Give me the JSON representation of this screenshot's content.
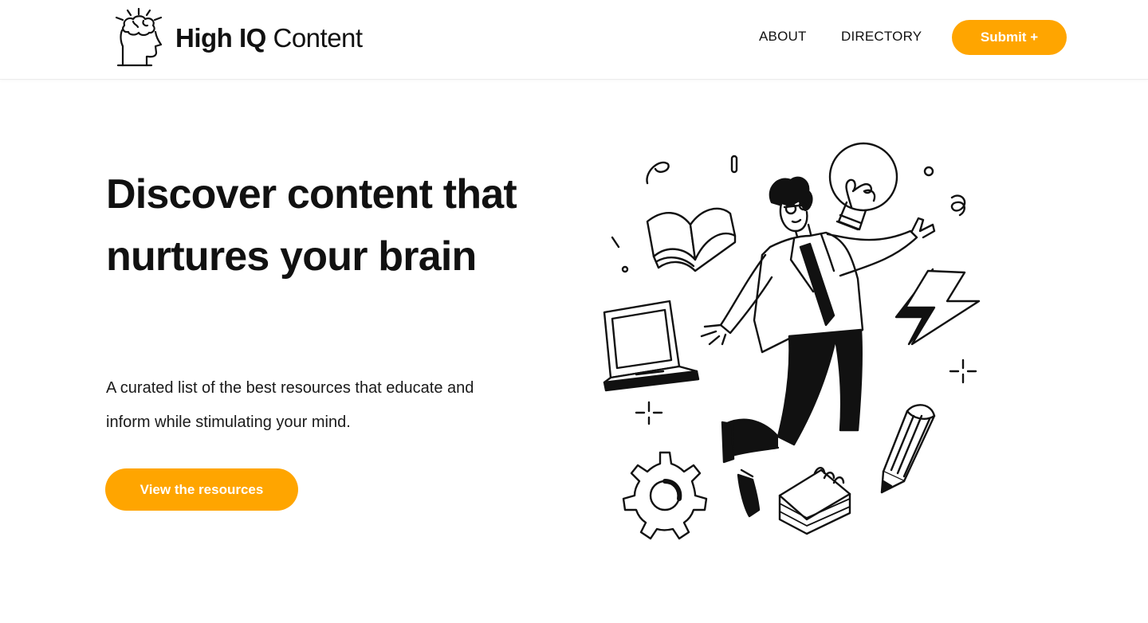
{
  "colors": {
    "accent": "#FFA500",
    "text": "#111111",
    "background": "#ffffff"
  },
  "header": {
    "brand": {
      "bold": "High IQ",
      "light": " Content",
      "logo_icon": "brain-head-icon"
    },
    "nav": [
      {
        "label": "ABOUT"
      },
      {
        "label": "DIRECTORY"
      }
    ],
    "submit_label": "Submit +"
  },
  "hero": {
    "title": "Discover content that nurtures your brain",
    "subtitle": "A curated list of the best resources that educate and inform while stimulating your mind.",
    "cta_label": "View the resources",
    "illustration_icons": [
      "person-icon",
      "book-icon",
      "laptop-icon",
      "lightbulb-icon",
      "lightning-icon",
      "gear-icon",
      "pencil-icon",
      "notepad-icon",
      "sparkle-icon"
    ]
  }
}
